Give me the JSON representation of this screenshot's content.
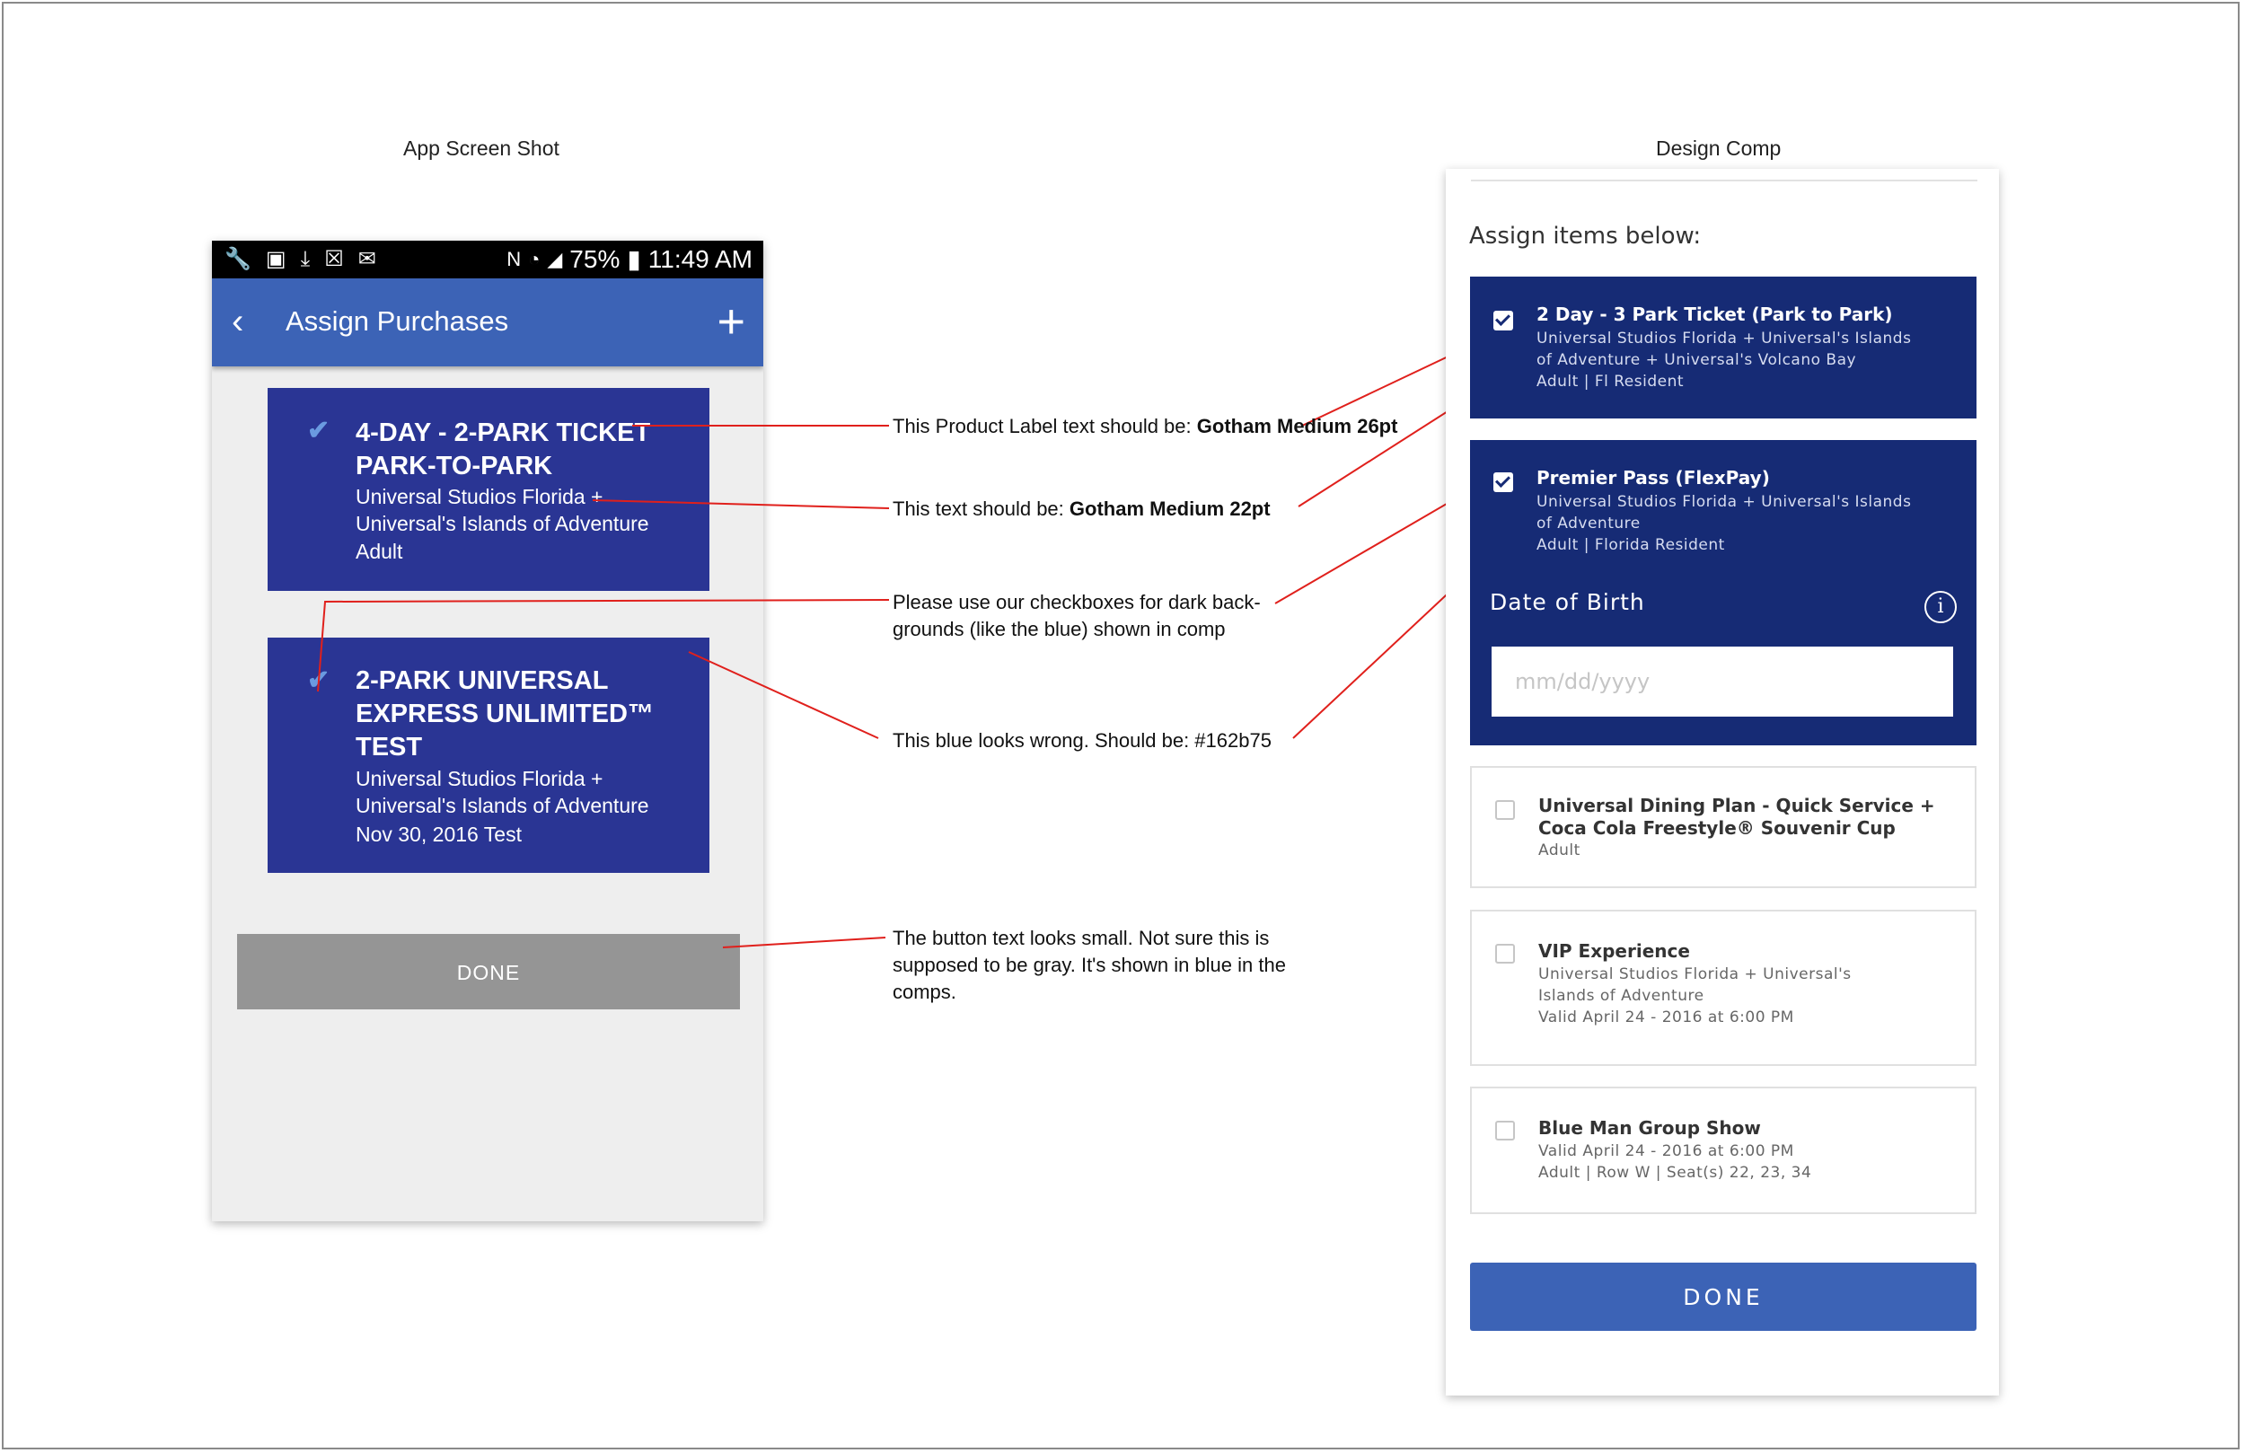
{
  "headings": {
    "left": "App Screen Shot",
    "right": "Design Comp"
  },
  "status_bar": {
    "left_icons": [
      "wrench-icon",
      "image-icon",
      "download-icon",
      "blocked-file-icon",
      "mail-icon"
    ],
    "nfc": "N",
    "battery": "75%",
    "time": "11:49 AM"
  },
  "app_bar": {
    "back": "‹",
    "title": "Assign Purchases",
    "add": "+"
  },
  "cards": [
    {
      "check": "✔",
      "title": "4-DAY - 2-PARK TICKET PARK-TO-PARK",
      "line1": "Universal Studios Florida +",
      "line2": "Universal's Islands of Adventure",
      "line3": "Adult"
    },
    {
      "check": "✔",
      "title": "2-PARK UNIVERSAL EXPRESS UNLIMITED™ TEST",
      "line1": "Universal Studios Florida +",
      "line2": "Universal's Islands of Adventure",
      "line3": "Nov 30, 2016 Test"
    }
  ],
  "app_done": "DONE",
  "notes": {
    "n1_pre": "This Product Label text should be: ",
    "n1_bold": "Gotham Medium 26pt",
    "n2_pre": "This text should be: ",
    "n2_bold": "Gotham Medium 22pt",
    "n3_line1": "Please use our checkboxes for dark back-",
    "n3_line2": "grounds (like the blue) shown in comp",
    "n4": "This blue looks wrong. Should be: #162b75",
    "n5_line1": "The button text looks small. Not sure this is",
    "n5_line2": "supposed to be gray. It's shown in blue in the",
    "n5_line3": "comps."
  },
  "comp": {
    "heading": "Assign items below:",
    "items": [
      {
        "title": "2 Day - 3 Park Ticket (Park to Park)",
        "d1": "Universal Studios Florida + Universal's Islands",
        "d2": "of Adventure + Universal's Volcano Bay",
        "d3": "Adult | Fl Resident",
        "checked": true
      },
      {
        "title": "Premier Pass (FlexPay)",
        "d1": "Universal Studios Florida + Universal's Islands",
        "d2": "of Adventure",
        "d3": "Adult  |  Florida Resident",
        "checked": true,
        "dob_label": "Date of Birth",
        "dob_placeholder": "mm/dd/yyyy",
        "info": "i"
      },
      {
        "title1": "Universal Dining Plan - Quick Service +",
        "title2": "Coca Cola Freestyle® Souvenir Cup",
        "d1": "Adult",
        "checked": false
      },
      {
        "title": "VIP Experience",
        "d1": "Universal Studios Florida + Universal's",
        "d2": "Islands of Adventure",
        "d3": "Valid April 24 - 2016 at 6:00 PM",
        "checked": false
      },
      {
        "title": "Blue Man Group Show",
        "d1": "Valid April 24 - 2016 at 6:00 PM",
        "d2": "Adult  |  Row W  |  Seat(s) 22, 23, 34",
        "checked": false
      }
    ],
    "done": "DONE"
  },
  "colors": {
    "app_card_blue": "#2a3594",
    "app_bar_blue": "#3c63b6",
    "comp_dark_blue": "#162b75",
    "annotation_line": "#e0201c",
    "app_done_gray": "#959595"
  }
}
